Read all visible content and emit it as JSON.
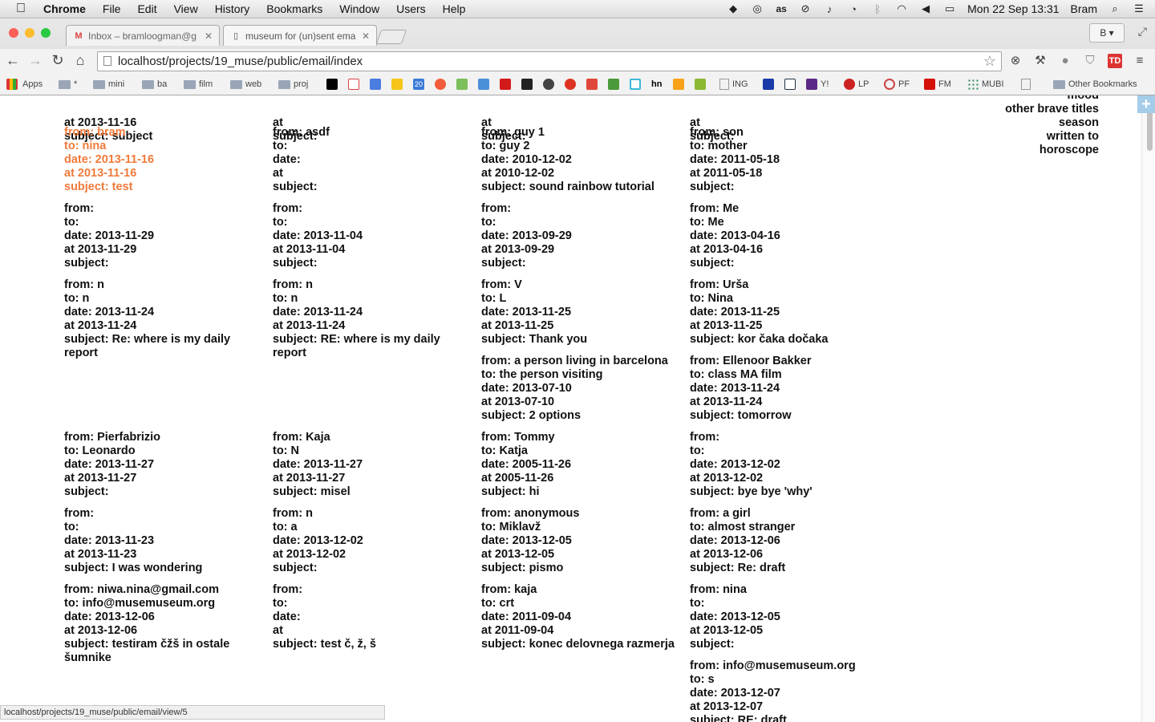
{
  "menubar": {
    "app": "Chrome",
    "items": [
      "File",
      "Edit",
      "View",
      "History",
      "Bookmarks",
      "Window",
      "Users",
      "Help"
    ],
    "clock": "Mon 22 Sep  13:31",
    "user": "Bram"
  },
  "tabs": [
    {
      "title": "Inbox – bramloogman@g"
    },
    {
      "title": "museum for (un)sent ema"
    }
  ],
  "profile_button": "B",
  "address": "localhost/projects/19_muse/public/email/index",
  "bookmarks": {
    "apps": "Apps",
    "items": [
      "*",
      "mini",
      "ba",
      "film",
      "web",
      "proj",
      "20",
      "hn",
      "ING",
      "Y!",
      "LP",
      "PF",
      "FM",
      "MUBI"
    ],
    "other": "Other Bookmarks"
  },
  "side_list": [
    "mood",
    "other brave titles",
    "season",
    "written to",
    "horoscope"
  ],
  "emails": {
    "c1": [
      {
        "from": "",
        "to": "",
        "date": "",
        "at": "at 2013-11-16",
        "subject": "subject: subject"
      },
      {
        "from": "from: bram",
        "to": "to: nina",
        "date": "date: 2013-11-16",
        "at": "at 2013-11-16",
        "subject": "subject: test"
      },
      {
        "from": "from:",
        "to": "to:",
        "date": "date: 2013-11-29",
        "at": "at 2013-11-29",
        "subject": "subject:"
      },
      {
        "from": "from: n",
        "to": "to: n",
        "date": "date: 2013-11-24",
        "at": "at 2013-11-24",
        "subject": "subject: Re: where is my daily report"
      },
      {
        "from": "from: Pierfabrizio",
        "to": "to: Leonardo",
        "date": "date: 2013-11-27",
        "at": "at 2013-11-27",
        "subject": "subject:"
      },
      {
        "from": "from:",
        "to": "to:",
        "date": "date: 2013-11-23",
        "at": "at 2013-11-23",
        "subject": "subject: I was wondering"
      },
      {
        "from": "from: niwa.nina@gmail.com",
        "to": "to: info@musemuseum.org",
        "date": "date: 2013-12-06",
        "at": "at 2013-12-06",
        "subject": "subject: testiram čžš in ostale šumnike"
      }
    ],
    "c2": [
      {
        "from": "",
        "to": "",
        "date": "",
        "at": "at",
        "subject": "subject:"
      },
      {
        "from": "from: asdf",
        "to": "to:",
        "date": "date:",
        "at": "at",
        "subject": "subject:"
      },
      {
        "from": "from:",
        "to": "to:",
        "date": "date: 2013-11-04",
        "at": "at 2013-11-04",
        "subject": "subject:"
      },
      {
        "from": "from: n",
        "to": "to: n",
        "date": "date: 2013-11-24",
        "at": "at 2013-11-24",
        "subject": "subject: RE: where is my daily report"
      },
      {
        "from": "from: Kaja",
        "to": "to: N",
        "date": "date: 2013-11-27",
        "at": "at 2013-11-27",
        "subject": "subject: misel"
      },
      {
        "from": "from: n",
        "to": "to: a",
        "date": "date: 2013-12-02",
        "at": "at 2013-12-02",
        "subject": "subject:"
      },
      {
        "from": "from:",
        "to": "to:",
        "date": "date:",
        "at": "at",
        "subject": "subject: test č, ž, š"
      }
    ],
    "c3": [
      {
        "from": "",
        "to": "",
        "date": "",
        "at": "at",
        "subject": "subject:"
      },
      {
        "from": "from: guy 1",
        "to": "to: guy 2",
        "date": "date: 2010-12-02",
        "at": "at 2010-12-02",
        "subject": "subject: sound rainbow tutorial"
      },
      {
        "from": "from:",
        "to": "to:",
        "date": "date: 2013-09-29",
        "at": "at 2013-09-29",
        "subject": "subject:"
      },
      {
        "from": "from: V",
        "to": "to: L",
        "date": "date: 2013-11-25",
        "at": "at 2013-11-25",
        "subject": "subject: Thank you"
      },
      {
        "from": "from: a person living in barcelona",
        "to": "to: the person visiting",
        "date": "date: 2013-07-10",
        "at": "at 2013-07-10",
        "subject": "subject: 2 options"
      },
      {
        "from": "from: Tommy",
        "to": "to: Katja",
        "date": "date: 2005-11-26",
        "at": "at 2005-11-26",
        "subject": "subject: hi"
      },
      {
        "from": "from: anonymous",
        "to": "to: Miklavž",
        "date": "date: 2013-12-05",
        "at": "at 2013-12-05",
        "subject": "subject: pismo"
      },
      {
        "from": "from: kaja",
        "to": "to: crt",
        "date": "date: 2011-09-04",
        "at": "at 2011-09-04",
        "subject": "subject: konec delovnega razmerja"
      }
    ],
    "c4": [
      {
        "from": "",
        "to": "",
        "date": "",
        "at": "at",
        "subject": "subject:"
      },
      {
        "from": "from: son",
        "to": "to: mother",
        "date": "date: 2011-05-18",
        "at": "at 2011-05-18",
        "subject": "subject:"
      },
      {
        "from": "from: Me",
        "to": "to: Me",
        "date": "date: 2013-04-16",
        "at": "at 2013-04-16",
        "subject": "subject:"
      },
      {
        "from": "from: Urša",
        "to": "to: Nina",
        "date": "date: 2013-11-25",
        "at": "at 2013-11-25",
        "subject": "subject: kor čaka dočaka"
      },
      {
        "from": "from: Ellenoor Bakker",
        "to": "to: class MA film",
        "date": "date: 2013-11-24",
        "at": "at 2013-11-24",
        "subject": "subject: tomorrow"
      },
      {
        "from": "from:",
        "to": "to:",
        "date": "date: 2013-12-02",
        "at": "at 2013-12-02",
        "subject": "subject: bye bye 'why'"
      },
      {
        "from": "from: a girl",
        "to": "to: almost stranger",
        "date": "date: 2013-12-06",
        "at": "at 2013-12-06",
        "subject": "subject: Re: draft"
      },
      {
        "from": "from: nina",
        "to": "to:",
        "date": "date: 2013-12-05",
        "at": "at 2013-12-05",
        "subject": "subject:"
      },
      {
        "from": "from: info@musemuseum.org",
        "to": "to: s",
        "date": "date: 2013-12-07",
        "at": "at 2013-12-07",
        "subject": "subject: RE: draft"
      }
    ]
  },
  "status_url": "localhost/projects/19_muse/public/email/view/5",
  "colors": {
    "active_email": "#f07a3a",
    "text": "#111111"
  }
}
